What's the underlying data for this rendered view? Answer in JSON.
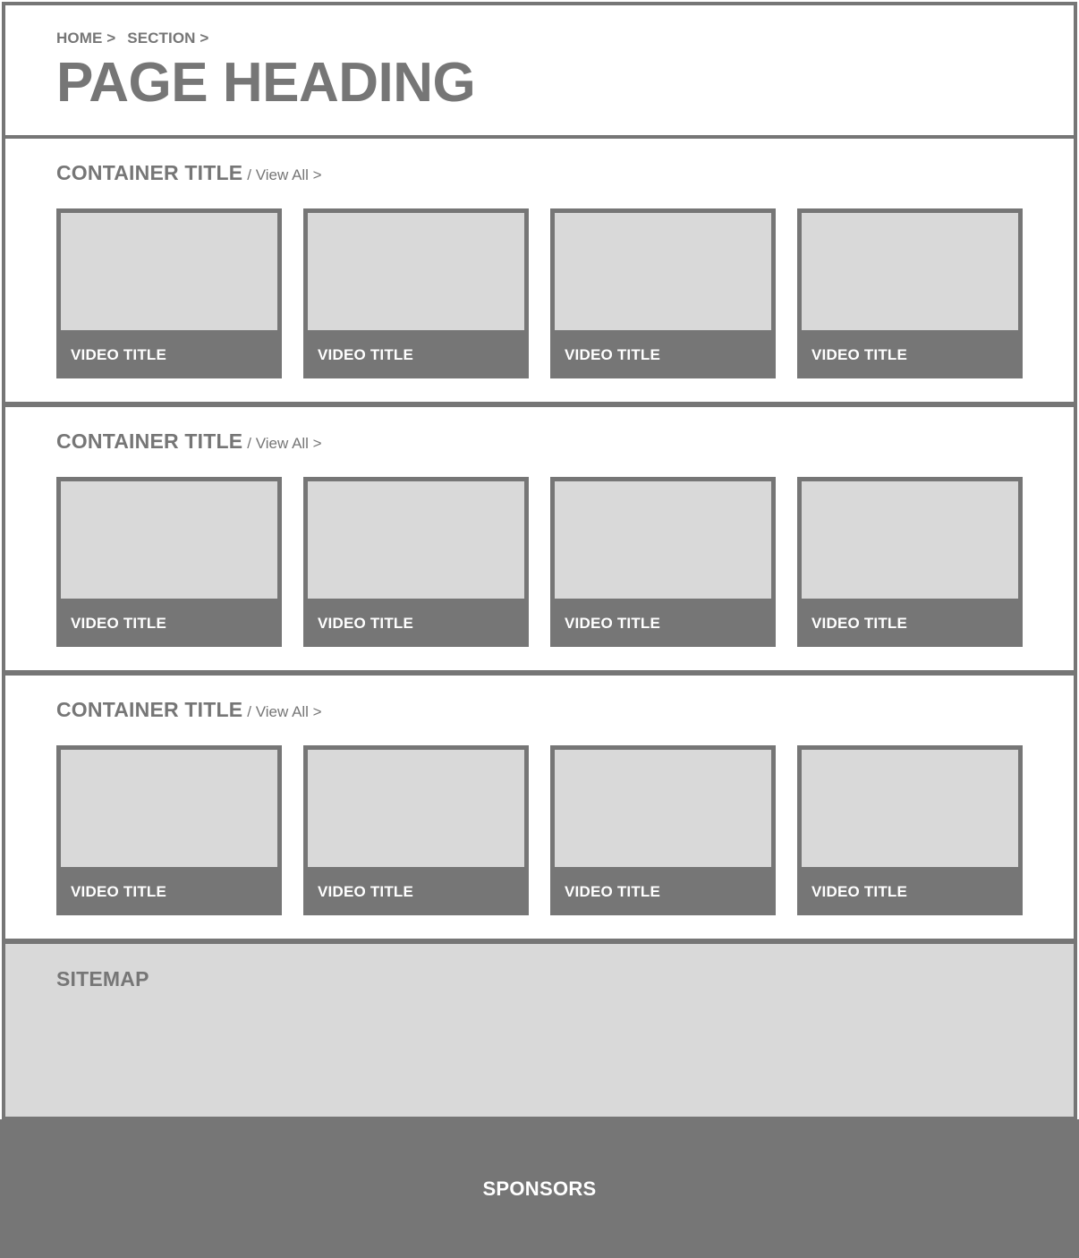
{
  "breadcrumb": [
    "HOME >",
    "SECTION >"
  ],
  "page_title": "PAGE HEADING",
  "sections": [
    {
      "title": "CONTAINER TITLE",
      "view_all": "/ View All >",
      "cards": [
        "VIDEO TITLE",
        "VIDEO TITLE",
        "VIDEO TITLE",
        "VIDEO TITLE"
      ]
    },
    {
      "title": "CONTAINER TITLE",
      "view_all": "/ View All >",
      "cards": [
        "VIDEO TITLE",
        "VIDEO TITLE",
        "VIDEO TITLE",
        "VIDEO TITLE"
      ]
    },
    {
      "title": "CONTAINER TITLE",
      "view_all": "/ View All >",
      "cards": [
        "VIDEO TITLE",
        "VIDEO TITLE",
        "VIDEO TITLE",
        "VIDEO TITLE"
      ]
    }
  ],
  "sitemap": {
    "title": "SITEMAP"
  },
  "sponsors": {
    "label": "SPONSORS"
  },
  "colors": {
    "primary_gray": "#767676",
    "light_gray": "#d9d9d9",
    "background": "#ffffff",
    "text_on_dark": "#ffffff"
  }
}
